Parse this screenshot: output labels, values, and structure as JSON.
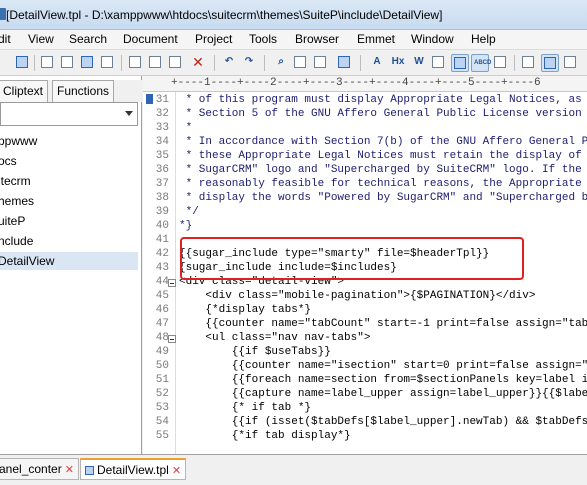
{
  "window": {
    "title": "[DetailView.tpl - D:\\xamppwww\\htdocs\\suitecrm\\themes\\SuiteP\\include\\DetailView]"
  },
  "menu": [
    "dit",
    "View",
    "Search",
    "Document",
    "Project",
    "Tools",
    "Browser",
    "Emmet",
    "Window",
    "Help"
  ],
  "toolbar": {
    "icons": [
      "save-icon",
      "print-icon",
      "spellcheck-icon",
      "preview-icon",
      "cut-icon",
      "copy-icon",
      "paste-icon",
      "delete-icon",
      "undo-icon",
      "redo-icon",
      "find-icon",
      "replace-icon",
      "go-to-icon",
      "font-icon",
      "hex-icon",
      "word-wrap-icon",
      "indent-icon",
      "column-mode-icon",
      "settings-icon",
      "view-icon",
      "output-icon",
      "clipboard-icon"
    ],
    "hex_label": "Hx",
    "abcd_label": "ABCD"
  },
  "left_panel": {
    "tabs": [
      "Cliptext",
      "Functions"
    ],
    "tree": [
      "ppwww",
      "ocs",
      "itecrm",
      "hemes",
      "uiteP",
      "nclude",
      "DetailView"
    ],
    "selected_index": 6
  },
  "ruler": "+----1----+----2----+----3----+----4----+----5----+----6",
  "editor": {
    "lines": [
      {
        "n": "31",
        "text": " * of this program must display Appropriate Legal Notices, as re",
        "cls": "comment"
      },
      {
        "n": "32",
        "text": " * Section 5 of the GNU Affero General Public License version 3.",
        "cls": "comment"
      },
      {
        "n": "33",
        "text": " *",
        "cls": "comment"
      },
      {
        "n": "34",
        "text": " * In accordance with Section 7(b) of the GNU Affero General Publ",
        "cls": "comment"
      },
      {
        "n": "35",
        "text": " * these Appropriate Legal Notices must retain the display of the",
        "cls": "comment"
      },
      {
        "n": "36",
        "text": " * SugarCRM\" logo and \"Supercharged by SuiteCRM\" logo. If the di",
        "cls": "comment"
      },
      {
        "n": "37",
        "text": " * reasonably feasible for technical reasons, the Appropriate Leg",
        "cls": "comment"
      },
      {
        "n": "38",
        "text": " * display the words \"Powered by SugarCRM\" and \"Supercharged by S",
        "cls": "comment"
      },
      {
        "n": "39",
        "text": " */",
        "cls": "comment"
      },
      {
        "n": "40",
        "text": "*}",
        "cls": "comment"
      },
      {
        "n": "41",
        "text": "",
        "cls": "tag"
      },
      {
        "n": "42",
        "text": "{{sugar_include type=\"smarty\" file=$headerTpl}}",
        "cls": "tag"
      },
      {
        "n": "43",
        "text": "{sugar_include include=$includes}",
        "cls": "tag"
      },
      {
        "n": "44",
        "text": "<div class=\"detail-view\">",
        "cls": "tag",
        "fold": true
      },
      {
        "n": "45",
        "text": "    <div class=\"mobile-pagination\">{$PAGINATION}</div>",
        "cls": "tag"
      },
      {
        "n": "46",
        "text": "    {*display tabs*}",
        "cls": "tag"
      },
      {
        "n": "47",
        "text": "    {{counter name=\"tabCount\" start=-1 print=false assign=\"tab",
        "cls": "tag"
      },
      {
        "n": "48",
        "text": "    <ul class=\"nav nav-tabs\">",
        "cls": "tag",
        "fold": true
      },
      {
        "n": "49",
        "text": "        {{if $useTabs}}",
        "cls": "tag"
      },
      {
        "n": "50",
        "text": "        {{counter name=\"isection\" start=0 print=false assign=\"",
        "cls": "tag"
      },
      {
        "n": "51",
        "text": "        {{foreach name=section from=$sectionPanels key=label it",
        "cls": "tag"
      },
      {
        "n": "52",
        "text": "        {{capture name=label_upper assign=label_upper}}{{$label",
        "cls": "tag"
      },
      {
        "n": "53",
        "text": "        {* if tab *}",
        "cls": "tag"
      },
      {
        "n": "54",
        "text": "        {{if (isset($tabDefs[$label_upper].newTab) && $tabDefs[$",
        "cls": "tag"
      },
      {
        "n": "55",
        "text": "        {*if tab display*}",
        "cls": "tag"
      }
    ]
  },
  "bottom_tabs": [
    {
      "label": "anel_conter",
      "active": false
    },
    {
      "label": "DetailView.tpl",
      "active": true
    }
  ]
}
